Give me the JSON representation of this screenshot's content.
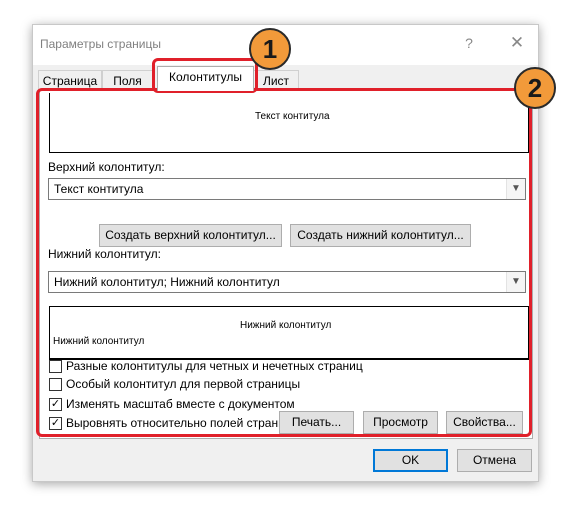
{
  "dialog": {
    "title": "Параметры страницы",
    "help_glyph": "?",
    "close_glyph": "✕"
  },
  "tabs": [
    {
      "label": "Страница",
      "active": false
    },
    {
      "label": "Поля",
      "active": false
    },
    {
      "label": "Колонтитулы",
      "active": true
    },
    {
      "label": "Лист",
      "active": false
    }
  ],
  "preview_top": {
    "text": "Текст контитула"
  },
  "header": {
    "label": "Верхний колонтитул:",
    "value": "Текст контитула",
    "create_button": "Создать верхний колонтитул...",
    "create_footer_button": "Создать нижний колонтитул..."
  },
  "footer": {
    "label": "Нижний колонтитул:",
    "value": "Нижний колонтитул; Нижний колонтитул"
  },
  "preview_bottom": {
    "center_text": "Нижний колонтитул",
    "left_text": "Нижний колонтитул"
  },
  "options": [
    {
      "label": "Разные колонтитулы для четных и нечетных страниц",
      "checked": false
    },
    {
      "label": "Особый колонтитул для первой страницы",
      "checked": false
    },
    {
      "label": "Изменять масштаб вместе с документом",
      "checked": true
    },
    {
      "label": "Выровнять относительно полей страницы",
      "checked": true
    }
  ],
  "panel_buttons": {
    "print": "Печать...",
    "preview": "Просмотр",
    "properties": "Свойства..."
  },
  "dialog_buttons": {
    "ok": "OK",
    "cancel": "Отмена"
  },
  "annotations": {
    "badge1": "1",
    "badge2": "2",
    "highlight_color": "#e0202a",
    "badge_color": "#f29a3a"
  },
  "icons": {
    "dropdown": "chevron-down-icon",
    "check": "check-icon"
  }
}
